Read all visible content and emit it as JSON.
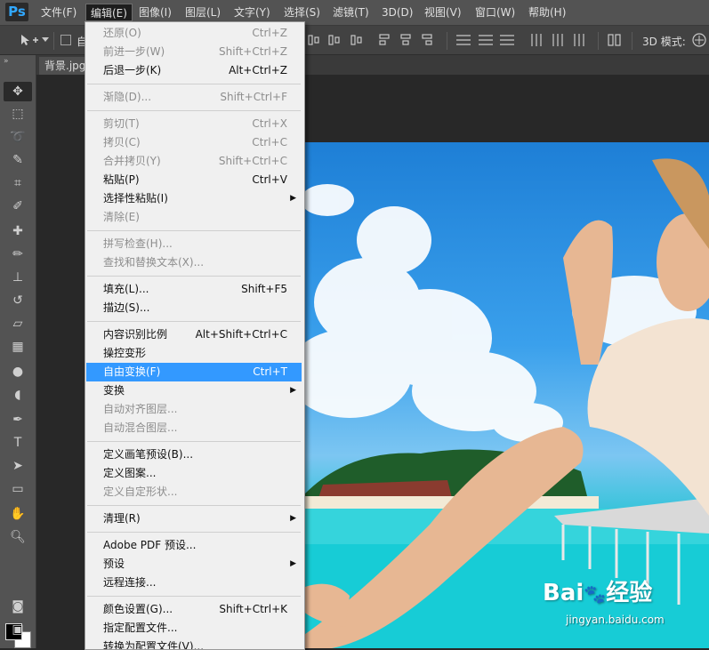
{
  "app": {
    "logo": "Ps"
  },
  "menubar": [
    {
      "label": "文件(F)"
    },
    {
      "label": "编辑(E)",
      "active": true
    },
    {
      "label": "图像(I)"
    },
    {
      "label": "图层(L)"
    },
    {
      "label": "文字(Y)"
    },
    {
      "label": "选择(S)"
    },
    {
      "label": "滤镜(T)"
    },
    {
      "label": "3D(D)"
    },
    {
      "label": "视图(V)"
    },
    {
      "label": "窗口(W)"
    },
    {
      "label": "帮助(H)"
    }
  ],
  "options_bar": {
    "tool_icon": "move-tool-icon",
    "auto_select_label": "自",
    "mode_3d_label": "3D 模式:"
  },
  "document": {
    "tab_label": "背景.jpg"
  },
  "edit_menu": {
    "items": [
      {
        "label": "还原(O)",
        "shortcut": "Ctrl+Z",
        "disabled": true
      },
      {
        "label": "前进一步(W)",
        "shortcut": "Shift+Ctrl+Z",
        "disabled": true
      },
      {
        "label": "后退一步(K)",
        "shortcut": "Alt+Ctrl+Z",
        "disabled": false
      },
      {
        "sep": true
      },
      {
        "label": "渐隐(D)...",
        "shortcut": "Shift+Ctrl+F",
        "disabled": true
      },
      {
        "sep": true
      },
      {
        "label": "剪切(T)",
        "shortcut": "Ctrl+X",
        "disabled": true
      },
      {
        "label": "拷贝(C)",
        "shortcut": "Ctrl+C",
        "disabled": true
      },
      {
        "label": "合并拷贝(Y)",
        "shortcut": "Shift+Ctrl+C",
        "disabled": true
      },
      {
        "label": "粘贴(P)",
        "shortcut": "Ctrl+V",
        "disabled": false
      },
      {
        "label": "选择性粘贴(I)",
        "shortcut": "",
        "disabled": false,
        "submenu": true
      },
      {
        "label": "清除(E)",
        "shortcut": "",
        "disabled": true
      },
      {
        "sep": true
      },
      {
        "label": "拼写检查(H)...",
        "shortcut": "",
        "disabled": true
      },
      {
        "label": "查找和替换文本(X)...",
        "shortcut": "",
        "disabled": true
      },
      {
        "sep": true
      },
      {
        "label": "填充(L)...",
        "shortcut": "Shift+F5",
        "disabled": false
      },
      {
        "label": "描边(S)...",
        "shortcut": "",
        "disabled": false
      },
      {
        "sep": true
      },
      {
        "label": "内容识别比例",
        "shortcut": "Alt+Shift+Ctrl+C",
        "disabled": false
      },
      {
        "label": "操控变形",
        "shortcut": "",
        "disabled": false
      },
      {
        "label": "自由变换(F)",
        "shortcut": "Ctrl+T",
        "disabled": false,
        "highlighted": true
      },
      {
        "label": "变换",
        "shortcut": "",
        "disabled": false,
        "submenu": true
      },
      {
        "label": "自动对齐图层...",
        "shortcut": "",
        "disabled": true
      },
      {
        "label": "自动混合图层...",
        "shortcut": "",
        "disabled": true
      },
      {
        "sep": true
      },
      {
        "label": "定义画笔预设(B)...",
        "shortcut": "",
        "disabled": false
      },
      {
        "label": "定义图案...",
        "shortcut": "",
        "disabled": false
      },
      {
        "label": "定义自定形状...",
        "shortcut": "",
        "disabled": true
      },
      {
        "sep": true
      },
      {
        "label": "清理(R)",
        "shortcut": "",
        "disabled": false,
        "submenu": true
      },
      {
        "sep": true
      },
      {
        "label": "Adobe PDF 预设...",
        "shortcut": "",
        "disabled": false
      },
      {
        "label": "预设",
        "shortcut": "",
        "disabled": false,
        "submenu": true
      },
      {
        "label": "远程连接...",
        "shortcut": "",
        "disabled": false
      },
      {
        "sep": true
      },
      {
        "label": "颜色设置(G)...",
        "shortcut": "Shift+Ctrl+K",
        "disabled": false
      },
      {
        "label": "指定配置文件...",
        "shortcut": "",
        "disabled": false
      },
      {
        "label": "转换为配置文件(V)...",
        "shortcut": "",
        "disabled": false
      }
    ]
  },
  "tools": [
    "move-tool-icon",
    "marquee-tool-icon",
    "lasso-tool-icon",
    "quick-select-tool-icon",
    "crop-tool-icon",
    "eyedropper-tool-icon",
    "healing-brush-tool-icon",
    "brush-tool-icon",
    "clone-stamp-tool-icon",
    "history-brush-tool-icon",
    "eraser-tool-icon",
    "gradient-tool-icon",
    "blur-tool-icon",
    "dodge-tool-icon",
    "pen-tool-icon",
    "type-tool-icon",
    "path-select-tool-icon",
    "rectangle-tool-icon",
    "hand-tool-icon",
    "zoom-tool-icon"
  ],
  "colors": {
    "foreground": "#000000",
    "background": "#ffffff",
    "highlight": "#3399ff"
  },
  "watermark": {
    "brand": "Bai",
    "brand2": "经验",
    "url": "jingyan.baidu.com"
  }
}
